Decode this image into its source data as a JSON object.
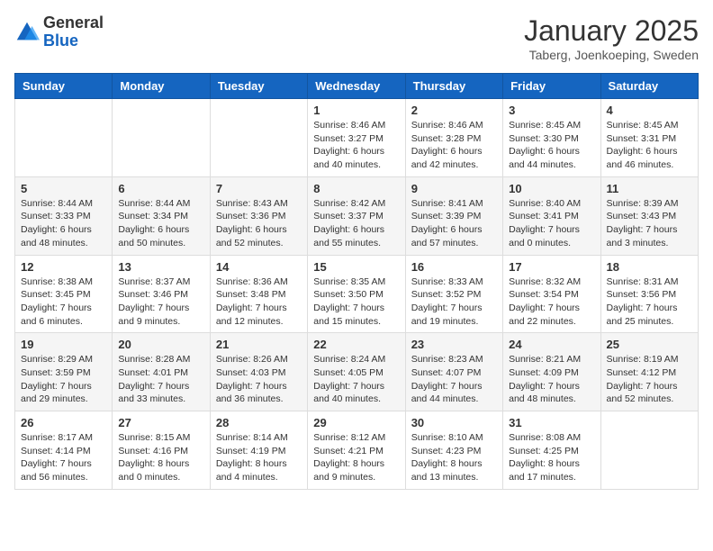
{
  "logo": {
    "general": "General",
    "blue": "Blue"
  },
  "title": "January 2025",
  "location": "Taberg, Joenkoeping, Sweden",
  "days_of_week": [
    "Sunday",
    "Monday",
    "Tuesday",
    "Wednesday",
    "Thursday",
    "Friday",
    "Saturday"
  ],
  "weeks": [
    [
      {
        "day": "",
        "info": ""
      },
      {
        "day": "",
        "info": ""
      },
      {
        "day": "",
        "info": ""
      },
      {
        "day": "1",
        "info": "Sunrise: 8:46 AM\nSunset: 3:27 PM\nDaylight: 6 hours\nand 40 minutes."
      },
      {
        "day": "2",
        "info": "Sunrise: 8:46 AM\nSunset: 3:28 PM\nDaylight: 6 hours\nand 42 minutes."
      },
      {
        "day": "3",
        "info": "Sunrise: 8:45 AM\nSunset: 3:30 PM\nDaylight: 6 hours\nand 44 minutes."
      },
      {
        "day": "4",
        "info": "Sunrise: 8:45 AM\nSunset: 3:31 PM\nDaylight: 6 hours\nand 46 minutes."
      }
    ],
    [
      {
        "day": "5",
        "info": "Sunrise: 8:44 AM\nSunset: 3:33 PM\nDaylight: 6 hours\nand 48 minutes."
      },
      {
        "day": "6",
        "info": "Sunrise: 8:44 AM\nSunset: 3:34 PM\nDaylight: 6 hours\nand 50 minutes."
      },
      {
        "day": "7",
        "info": "Sunrise: 8:43 AM\nSunset: 3:36 PM\nDaylight: 6 hours\nand 52 minutes."
      },
      {
        "day": "8",
        "info": "Sunrise: 8:42 AM\nSunset: 3:37 PM\nDaylight: 6 hours\nand 55 minutes."
      },
      {
        "day": "9",
        "info": "Sunrise: 8:41 AM\nSunset: 3:39 PM\nDaylight: 6 hours\nand 57 minutes."
      },
      {
        "day": "10",
        "info": "Sunrise: 8:40 AM\nSunset: 3:41 PM\nDaylight: 7 hours\nand 0 minutes."
      },
      {
        "day": "11",
        "info": "Sunrise: 8:39 AM\nSunset: 3:43 PM\nDaylight: 7 hours\nand 3 minutes."
      }
    ],
    [
      {
        "day": "12",
        "info": "Sunrise: 8:38 AM\nSunset: 3:45 PM\nDaylight: 7 hours\nand 6 minutes."
      },
      {
        "day": "13",
        "info": "Sunrise: 8:37 AM\nSunset: 3:46 PM\nDaylight: 7 hours\nand 9 minutes."
      },
      {
        "day": "14",
        "info": "Sunrise: 8:36 AM\nSunset: 3:48 PM\nDaylight: 7 hours\nand 12 minutes."
      },
      {
        "day": "15",
        "info": "Sunrise: 8:35 AM\nSunset: 3:50 PM\nDaylight: 7 hours\nand 15 minutes."
      },
      {
        "day": "16",
        "info": "Sunrise: 8:33 AM\nSunset: 3:52 PM\nDaylight: 7 hours\nand 19 minutes."
      },
      {
        "day": "17",
        "info": "Sunrise: 8:32 AM\nSunset: 3:54 PM\nDaylight: 7 hours\nand 22 minutes."
      },
      {
        "day": "18",
        "info": "Sunrise: 8:31 AM\nSunset: 3:56 PM\nDaylight: 7 hours\nand 25 minutes."
      }
    ],
    [
      {
        "day": "19",
        "info": "Sunrise: 8:29 AM\nSunset: 3:59 PM\nDaylight: 7 hours\nand 29 minutes."
      },
      {
        "day": "20",
        "info": "Sunrise: 8:28 AM\nSunset: 4:01 PM\nDaylight: 7 hours\nand 33 minutes."
      },
      {
        "day": "21",
        "info": "Sunrise: 8:26 AM\nSunset: 4:03 PM\nDaylight: 7 hours\nand 36 minutes."
      },
      {
        "day": "22",
        "info": "Sunrise: 8:24 AM\nSunset: 4:05 PM\nDaylight: 7 hours\nand 40 minutes."
      },
      {
        "day": "23",
        "info": "Sunrise: 8:23 AM\nSunset: 4:07 PM\nDaylight: 7 hours\nand 44 minutes."
      },
      {
        "day": "24",
        "info": "Sunrise: 8:21 AM\nSunset: 4:09 PM\nDaylight: 7 hours\nand 48 minutes."
      },
      {
        "day": "25",
        "info": "Sunrise: 8:19 AM\nSunset: 4:12 PM\nDaylight: 7 hours\nand 52 minutes."
      }
    ],
    [
      {
        "day": "26",
        "info": "Sunrise: 8:17 AM\nSunset: 4:14 PM\nDaylight: 7 hours\nand 56 minutes."
      },
      {
        "day": "27",
        "info": "Sunrise: 8:15 AM\nSunset: 4:16 PM\nDaylight: 8 hours\nand 0 minutes."
      },
      {
        "day": "28",
        "info": "Sunrise: 8:14 AM\nSunset: 4:19 PM\nDaylight: 8 hours\nand 4 minutes."
      },
      {
        "day": "29",
        "info": "Sunrise: 8:12 AM\nSunset: 4:21 PM\nDaylight: 8 hours\nand 9 minutes."
      },
      {
        "day": "30",
        "info": "Sunrise: 8:10 AM\nSunset: 4:23 PM\nDaylight: 8 hours\nand 13 minutes."
      },
      {
        "day": "31",
        "info": "Sunrise: 8:08 AM\nSunset: 4:25 PM\nDaylight: 8 hours\nand 17 minutes."
      },
      {
        "day": "",
        "info": ""
      }
    ]
  ]
}
